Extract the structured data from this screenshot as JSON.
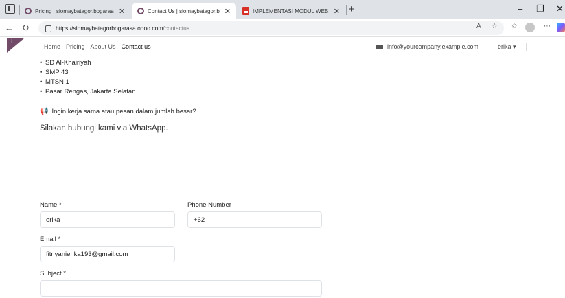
{
  "browser": {
    "tabs": [
      {
        "label": "Pricing | siomaybatagor.bogarasa",
        "favicon": "odoo-icon",
        "active": false
      },
      {
        "label": "Contact Us | siomaybatagor.boga",
        "favicon": "odoo-icon",
        "active": true
      },
      {
        "label": "IMPLEMENTASI MODUL WEBSITE",
        "favicon": "pdf-icon",
        "active": false
      }
    ],
    "url_host": "https://siomaybatagorbogarasa.odoo.com",
    "url_path": "/contactus"
  },
  "site": {
    "brand_color": "#714b67",
    "menu": [
      {
        "label": "Home"
      },
      {
        "label": "Pricing"
      },
      {
        "label": "About Us"
      },
      {
        "label": "Contact us",
        "active": true
      }
    ],
    "email": "info@yourcompany.example.com",
    "user": "erika"
  },
  "content": {
    "locations": [
      "SD Al-Khairiyah",
      "SMP 43",
      "MTSN 1",
      "Pasar Rengas, Jakarta Selatan"
    ],
    "promo_text": "Ingin kerja sama atau pesan dalam jumlah besar?",
    "whatsapp_text": "Silakan hubungi kami via WhatsApp."
  },
  "form": {
    "name_label": "Name *",
    "name_value": "erika",
    "phone_label": "Phone Number",
    "phone_value": "+62",
    "email_label": "Email *",
    "email_value": "fitriyanierika193@gmail.com",
    "subject_label": "Subject *",
    "subject_value": ""
  }
}
